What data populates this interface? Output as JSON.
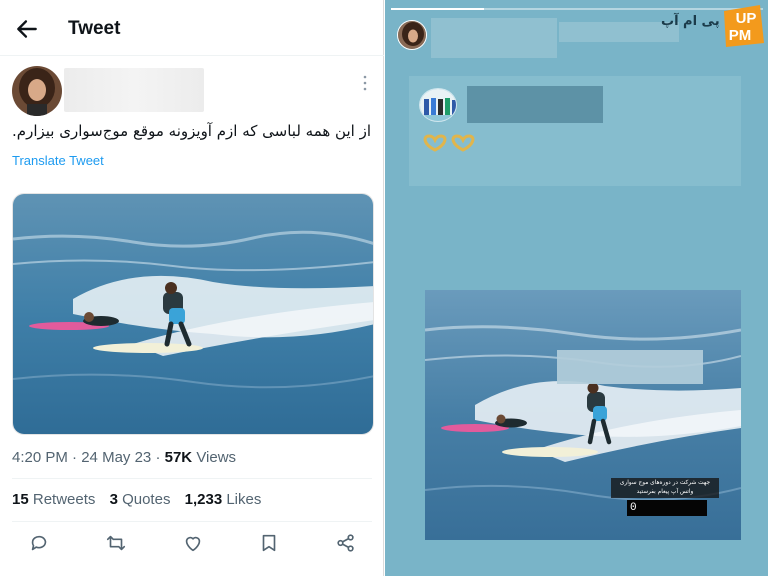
{
  "tweet": {
    "header_title": "Tweet",
    "text": "از این همه لباسی که ازم آویزونه موقع موج‌سواری بیزارم.",
    "translate_label": "Translate Tweet",
    "time": "4:20 PM",
    "date": "24 May 23",
    "views_count": "57K",
    "views_label": "Views",
    "retweets_count": "15",
    "retweets_label": "Retweets",
    "quotes_count": "3",
    "quotes_label": "Quotes",
    "likes_count": "1,233",
    "likes_label": "Likes",
    "actions": [
      "reply-icon",
      "retweet-icon",
      "like-icon",
      "bookmark-icon",
      "share-icon"
    ]
  },
  "story": {
    "progress": 0.25,
    "brand_wordmark": "پی ام آپ",
    "brand_logo_top": "UP",
    "brand_logo_bottom": "PM",
    "hearts": "🫶🫶",
    "promo_text_line1": "جهت شرکت در دوره‌های موج سواری",
    "promo_text_line2": "واتس آپ پیغام بفرستید",
    "phone_prefix": "0"
  },
  "colors": {
    "accent": "#1d9bf0",
    "brand_orange": "#f39a1c",
    "story_bg": "#79b4c8"
  }
}
